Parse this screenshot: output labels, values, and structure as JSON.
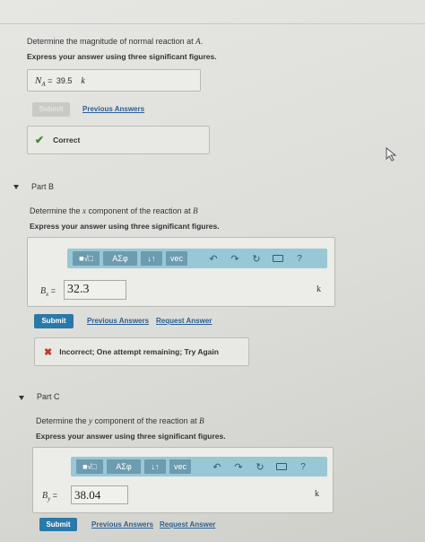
{
  "part_a": {
    "question_pre": "Determine the magnitude of normal reaction at ",
    "question_var": "A",
    "question_post": ".",
    "instruction": "Express your answer using three significant figures.",
    "answer_label": "N",
    "answer_sub": "A",
    "answer_eq": " = ",
    "answer_value": "39.5",
    "answer_unit": "k",
    "submit_label": "Submit",
    "previous_answers": "Previous Answers",
    "feedback": "Correct"
  },
  "part_b": {
    "title": "Part B",
    "question_pre": "Determine the ",
    "question_var": "x",
    "question_mid": " component of the reaction at ",
    "question_var2": "B",
    "instruction": "Express your answer using three significant figures.",
    "toolbar": {
      "templates": "■√□",
      "symbols": "ΑΣφ",
      "arrows": "↓↑",
      "vec": "vec",
      "help": "?"
    },
    "label": "B",
    "label_sub": "x",
    "label_eq": " = ",
    "input_value": "32.3",
    "unit": "k",
    "submit_label": "Submit",
    "previous_answers": "Previous Answers",
    "request_answer": "Request Answer",
    "feedback": "Incorrect; One attempt remaining; Try Again"
  },
  "part_c": {
    "title": "Part C",
    "question_pre": "Determine the ",
    "question_var": "y",
    "question_mid": " component of the reaction at ",
    "question_var2": "B",
    "instruction": "Express your answer using three significant figures.",
    "toolbar": {
      "templates": "■√□",
      "symbols": "ΑΣφ",
      "arrows": "↓↑",
      "vec": "vec",
      "help": "?"
    },
    "label": "B",
    "label_sub": "y",
    "label_eq": " = ",
    "input_value": "38.04",
    "unit": "k",
    "submit_label": "Submit",
    "previous_answers": "Previous Answers",
    "request_answer": "Request Answer"
  },
  "colors": {
    "submit": "#2a79a8",
    "toolbar": "#98c7d6",
    "correct": "#3e8a2c",
    "incorrect": "#c0392b"
  }
}
